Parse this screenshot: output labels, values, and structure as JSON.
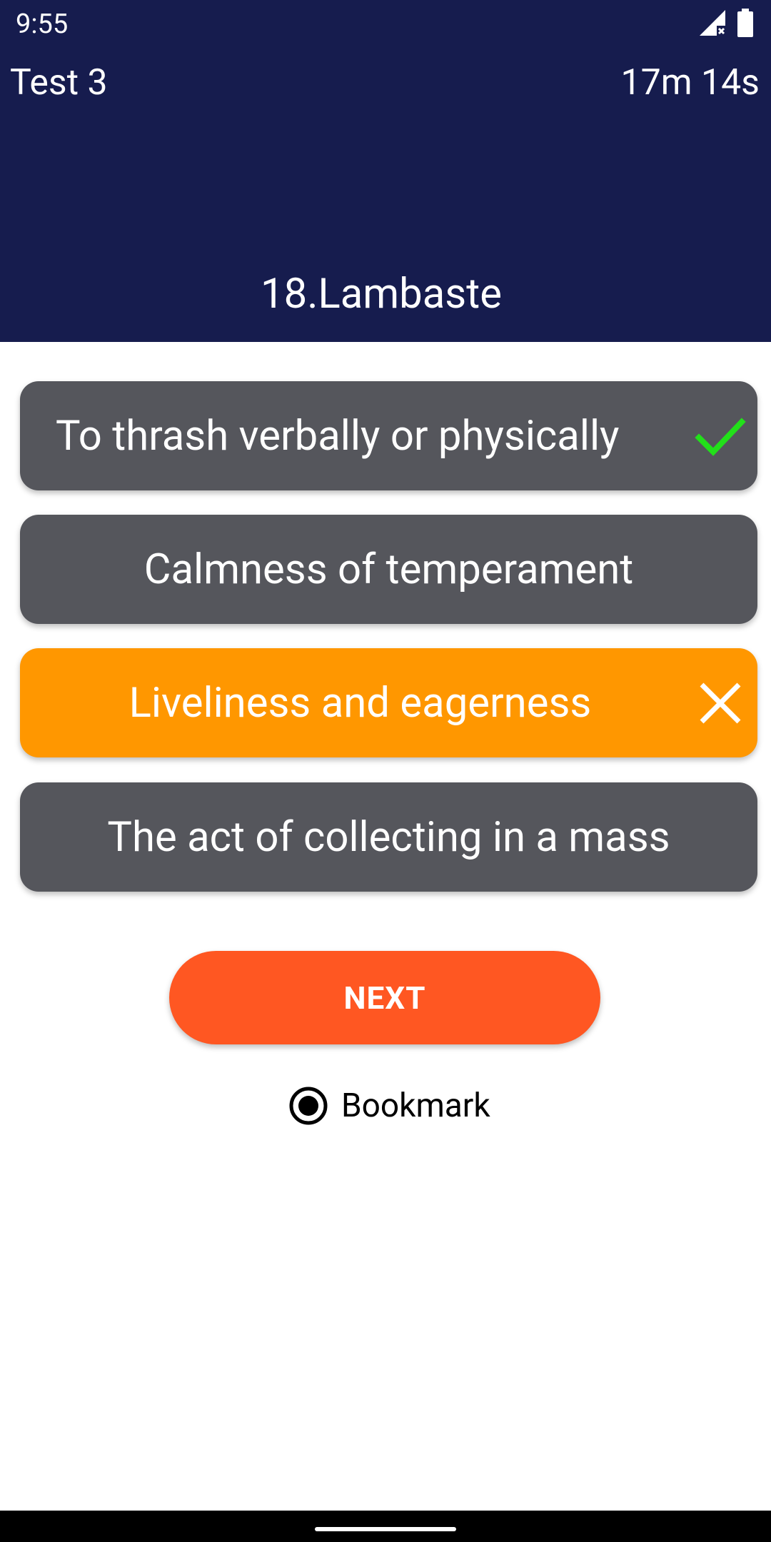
{
  "status_bar": {
    "time": "9:55"
  },
  "header": {
    "test_title": "Test 3",
    "timer": "17m 14s",
    "question": "18.Lambaste",
    "background_color": "#161c4e"
  },
  "options": [
    {
      "label": "To thrash verbally or physically",
      "state": "correct",
      "icon": "check-icon"
    },
    {
      "label": "Calmness of temperament",
      "state": "neutral",
      "icon": ""
    },
    {
      "label": "Liveliness and eagerness",
      "state": "wrong",
      "icon": "close-icon"
    },
    {
      "label": "The act of collecting in a mass",
      "state": "neutral",
      "icon": ""
    }
  ],
  "colors": {
    "option_default": "#55565c",
    "option_wrong": "#ff9700",
    "correct_check": "#22e01a",
    "next_button": "#ff5722"
  },
  "next_button": {
    "label": "NEXT"
  },
  "bookmark": {
    "label": "Bookmark",
    "selected": true
  }
}
